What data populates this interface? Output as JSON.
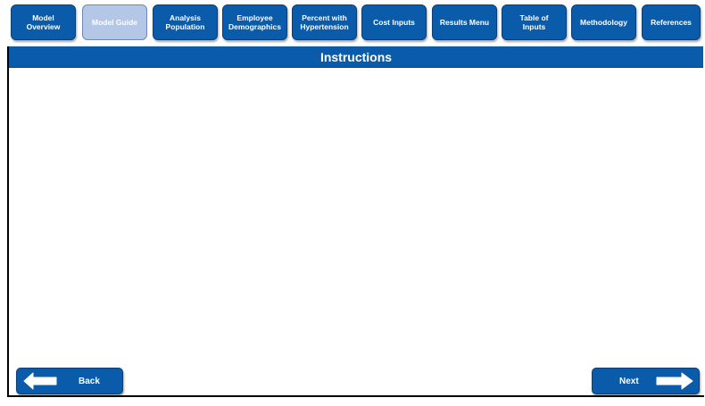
{
  "nav": {
    "items": [
      {
        "label": "Model\nOverview"
      },
      {
        "label": "Model Guide"
      },
      {
        "label": "Analysis\nPopulation"
      },
      {
        "label": "Employee\nDemographics"
      },
      {
        "label": "Percent with\nHypertension"
      },
      {
        "label": "Cost Inputs"
      },
      {
        "label": "Results Menu"
      },
      {
        "label": "Table of\nInputs"
      },
      {
        "label": "Methodology"
      },
      {
        "label": "References"
      }
    ],
    "active_index": 1
  },
  "section": {
    "title": "Instructions"
  },
  "footer": {
    "back_label": "Back",
    "next_label": "Next"
  },
  "colors": {
    "primary": "#0a5cab",
    "active_tab": "#b4c7e7"
  },
  "icons": {
    "back": "arrow-left-icon",
    "next": "arrow-right-icon"
  }
}
